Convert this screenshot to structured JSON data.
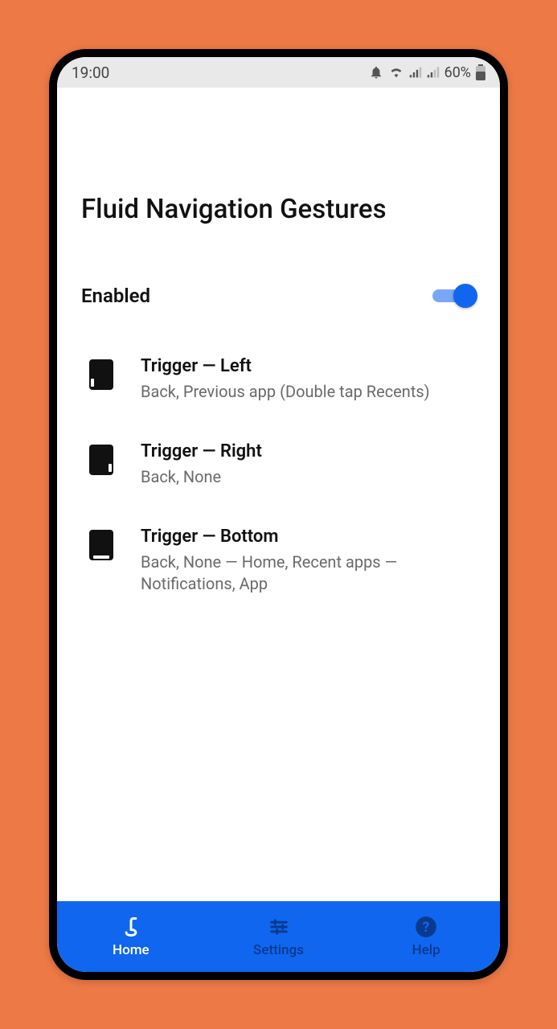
{
  "status": {
    "time": "19:00",
    "battery_percent": "60%"
  },
  "page": {
    "title": "Fluid Navigation Gestures"
  },
  "enable": {
    "label": "Enabled",
    "value": true
  },
  "triggers": [
    {
      "side": "left",
      "title": "Trigger — Left",
      "subtitle": "Back, Previous app (Double tap Recents)"
    },
    {
      "side": "right",
      "title": "Trigger — Right",
      "subtitle": "Back, None"
    },
    {
      "side": "bottom",
      "title": "Trigger — Bottom",
      "subtitle": "Back, None — Home, Recent apps — Notifications, App"
    }
  ],
  "nav": {
    "home": {
      "label": "Home",
      "active": true
    },
    "settings": {
      "label": "Settings",
      "active": false
    },
    "help": {
      "label": "Help",
      "active": false
    }
  },
  "colors": {
    "background": "#ed7a46",
    "accent": "#1066ee"
  }
}
